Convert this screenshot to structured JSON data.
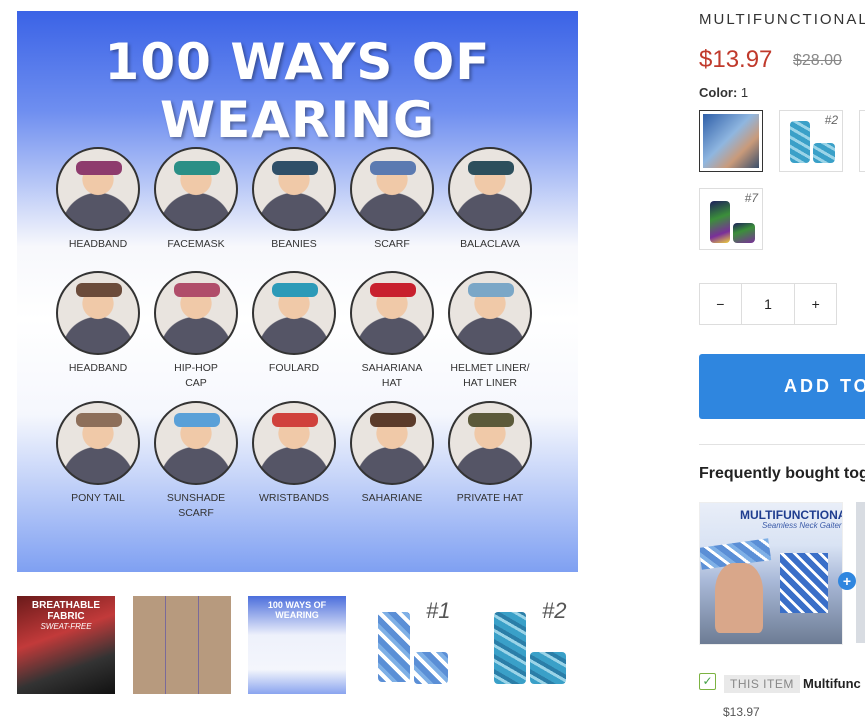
{
  "product": {
    "title": "MULTIFUNCTIONAL",
    "price": "$13.97",
    "old_price": "$28.00",
    "color_label": "Color:",
    "color_value": "1",
    "swatches": [
      {
        "label": ""
      },
      {
        "label": "#2"
      },
      {
        "label": "#7"
      }
    ],
    "quantity": "1",
    "qty_minus": "−",
    "qty_plus": "+",
    "add_to_cart": "ADD TO"
  },
  "main_image": {
    "headline": "100 WAYS OF WEARING",
    "styles": [
      {
        "label": "HEADBAND",
        "color": "#8e3b6d"
      },
      {
        "label": "FACEMASK",
        "color": "#2a8f86"
      },
      {
        "label": "BEANIES",
        "color": "#2f4f68"
      },
      {
        "label": "SCARF",
        "color": "#5b7ab1"
      },
      {
        "label": "BALACLAVA",
        "color": "#2d4f5c"
      },
      {
        "label": "HEADBAND",
        "color": "#6b4b3a"
      },
      {
        "label": "HIP-HOP\nCAP",
        "color": "#b04d6a"
      },
      {
        "label": "FOULARD",
        "color": "#2c9ab8"
      },
      {
        "label": "SAHARIANA\nHAT",
        "color": "#c8202d"
      },
      {
        "label": "HELMET LINER/\nHAT LINER",
        "color": "#7ba7c7"
      },
      {
        "label": "PONY TAIL",
        "color": "#8d6f5a"
      },
      {
        "label": "SUNSHADE\nSCARF",
        "color": "#5aa0d8"
      },
      {
        "label": "WRISTBANDS",
        "color": "#d0413c"
      },
      {
        "label": "SAHARIANE",
        "color": "#5b3b2a"
      },
      {
        "label": "PRIVATE HAT",
        "color": "#5c5a3a"
      }
    ]
  },
  "thumbnails": [
    {
      "title": "BREATHABLE FABRIC",
      "subtitle": "SWEAT-FREE"
    },
    {
      "title": ""
    },
    {
      "title": "100 WAYS OF WEARING"
    },
    {
      "title": "#1"
    },
    {
      "title": "#2"
    }
  ],
  "fbt": {
    "title": "Frequently bought tog",
    "image_headline": "MULTIFUNCTIONAL",
    "image_sub": "Seamless Neck Gaiter",
    "plus": "+",
    "check": "✓",
    "this_item": "THIS ITEM",
    "item_name": "Multifunc",
    "item_price": "$13.97"
  }
}
